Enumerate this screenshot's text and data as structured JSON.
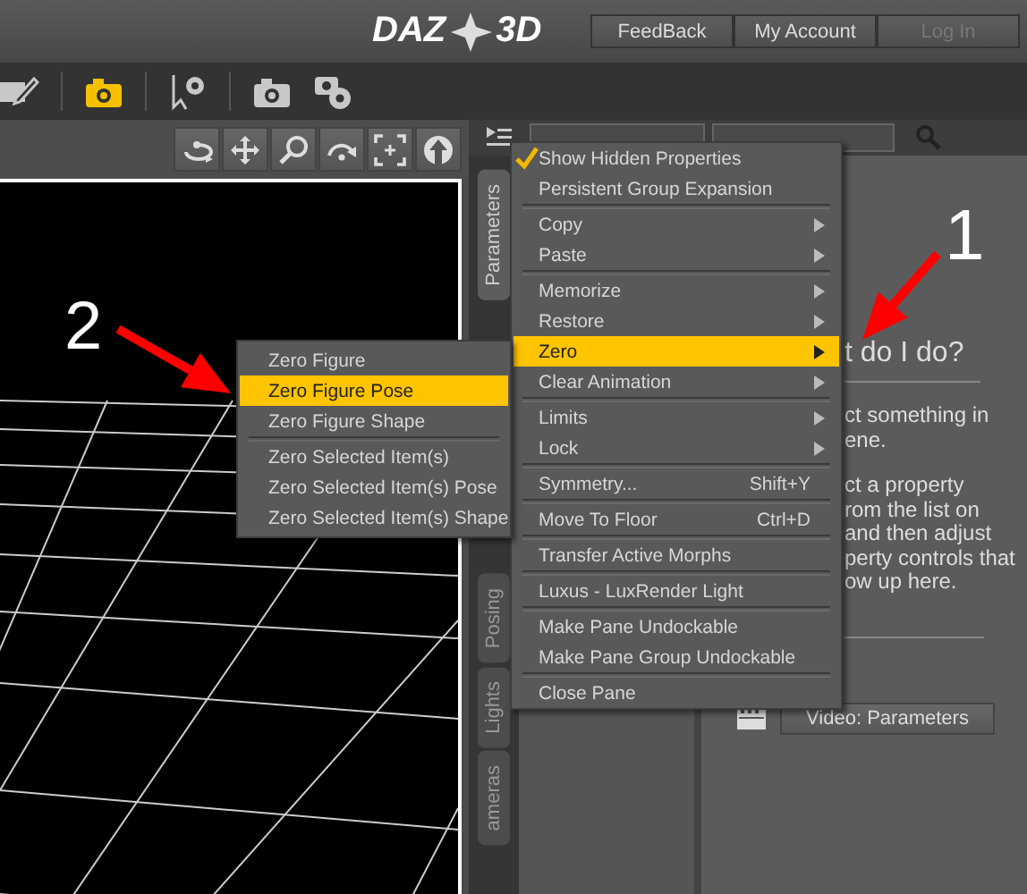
{
  "logo": {
    "left": "DAZ",
    "right": "3D"
  },
  "header_buttons": [
    {
      "label": "FeedBack",
      "disabled": false
    },
    {
      "label": "My Account",
      "disabled": false
    },
    {
      "label": "Log In",
      "disabled": true
    }
  ],
  "toolbar": [
    {
      "kind": "pencil",
      "selected": false
    },
    {
      "kind": "camera",
      "selected": true
    },
    {
      "kind": "cursor-gear",
      "selected": false
    },
    {
      "kind": "camera",
      "selected": false
    },
    {
      "kind": "camera-gear",
      "selected": false
    }
  ],
  "viewport_tools": [
    {
      "kind": "orbit"
    },
    {
      "kind": "move"
    },
    {
      "kind": "zoom"
    },
    {
      "kind": "arc"
    },
    {
      "kind": "frame"
    },
    {
      "kind": "home"
    }
  ],
  "side_tabs": [
    {
      "label": "Parameters",
      "selected": true
    },
    {
      "label": "Posing",
      "selected": false
    },
    {
      "label": "Lights",
      "selected": false
    },
    {
      "label": "ameras",
      "selected": false
    }
  ],
  "help": {
    "heading": "t do I do?",
    "paragraphs": [
      [
        "ct something in",
        "ene."
      ],
      [
        "ct a property",
        "rom the list on",
        "and then adjust",
        "perty controls that",
        "ow up here."
      ]
    ],
    "video_button": "Video: Parameters"
  },
  "context_menu": [
    [
      {
        "label": "Show Hidden Properties",
        "checked": true,
        "submenu": false,
        "selected": false
      },
      {
        "label": "Persistent Group Expansion",
        "checked": false,
        "submenu": false,
        "selected": false
      }
    ],
    [
      {
        "label": "Copy",
        "checked": false,
        "submenu": true,
        "selected": false
      },
      {
        "label": "Paste",
        "checked": false,
        "submenu": true,
        "selected": false
      }
    ],
    [
      {
        "label": "Memorize",
        "checked": false,
        "submenu": true,
        "selected": false
      },
      {
        "label": "Restore",
        "checked": false,
        "submenu": true,
        "selected": false
      },
      {
        "label": "Zero",
        "checked": false,
        "submenu": true,
        "selected": true
      },
      {
        "label": "Clear Animation",
        "checked": false,
        "submenu": true,
        "selected": false
      }
    ],
    [
      {
        "label": "Limits",
        "checked": false,
        "submenu": true,
        "selected": false
      },
      {
        "label": "Lock",
        "checked": false,
        "submenu": true,
        "selected": false
      }
    ],
    [
      {
        "label": "Symmetry...",
        "shortcut": "Shift+Y",
        "checked": false,
        "submenu": false,
        "selected": false
      }
    ],
    [
      {
        "label": "Move To Floor",
        "shortcut": "Ctrl+D",
        "checked": false,
        "submenu": false,
        "selected": false
      }
    ],
    [
      {
        "label": "Transfer Active Morphs",
        "checked": false,
        "submenu": false,
        "selected": false
      }
    ],
    [
      {
        "label": "Luxus - LuxRender Light",
        "checked": false,
        "submenu": false,
        "selected": false
      }
    ],
    [
      {
        "label": "Make Pane Undockable",
        "checked": false,
        "submenu": false,
        "selected": false
      },
      {
        "label": "Make Pane Group Undockable",
        "checked": false,
        "submenu": false,
        "selected": false
      }
    ],
    [
      {
        "label": "Close Pane",
        "checked": false,
        "submenu": false,
        "selected": false
      }
    ]
  ],
  "zero_submenu": [
    [
      {
        "label": "Zero Figure",
        "selected": false
      },
      {
        "label": "Zero Figure Pose",
        "selected": true
      },
      {
        "label": "Zero Figure Shape",
        "selected": false
      }
    ],
    [
      {
        "label": "Zero Selected Item(s)",
        "selected": false
      },
      {
        "label": "Zero Selected Item(s) Pose",
        "selected": false
      },
      {
        "label": "Zero Selected Item(s) Shape",
        "selected": false
      }
    ]
  ],
  "annotations": [
    {
      "label": "1"
    },
    {
      "label": "2"
    }
  ]
}
